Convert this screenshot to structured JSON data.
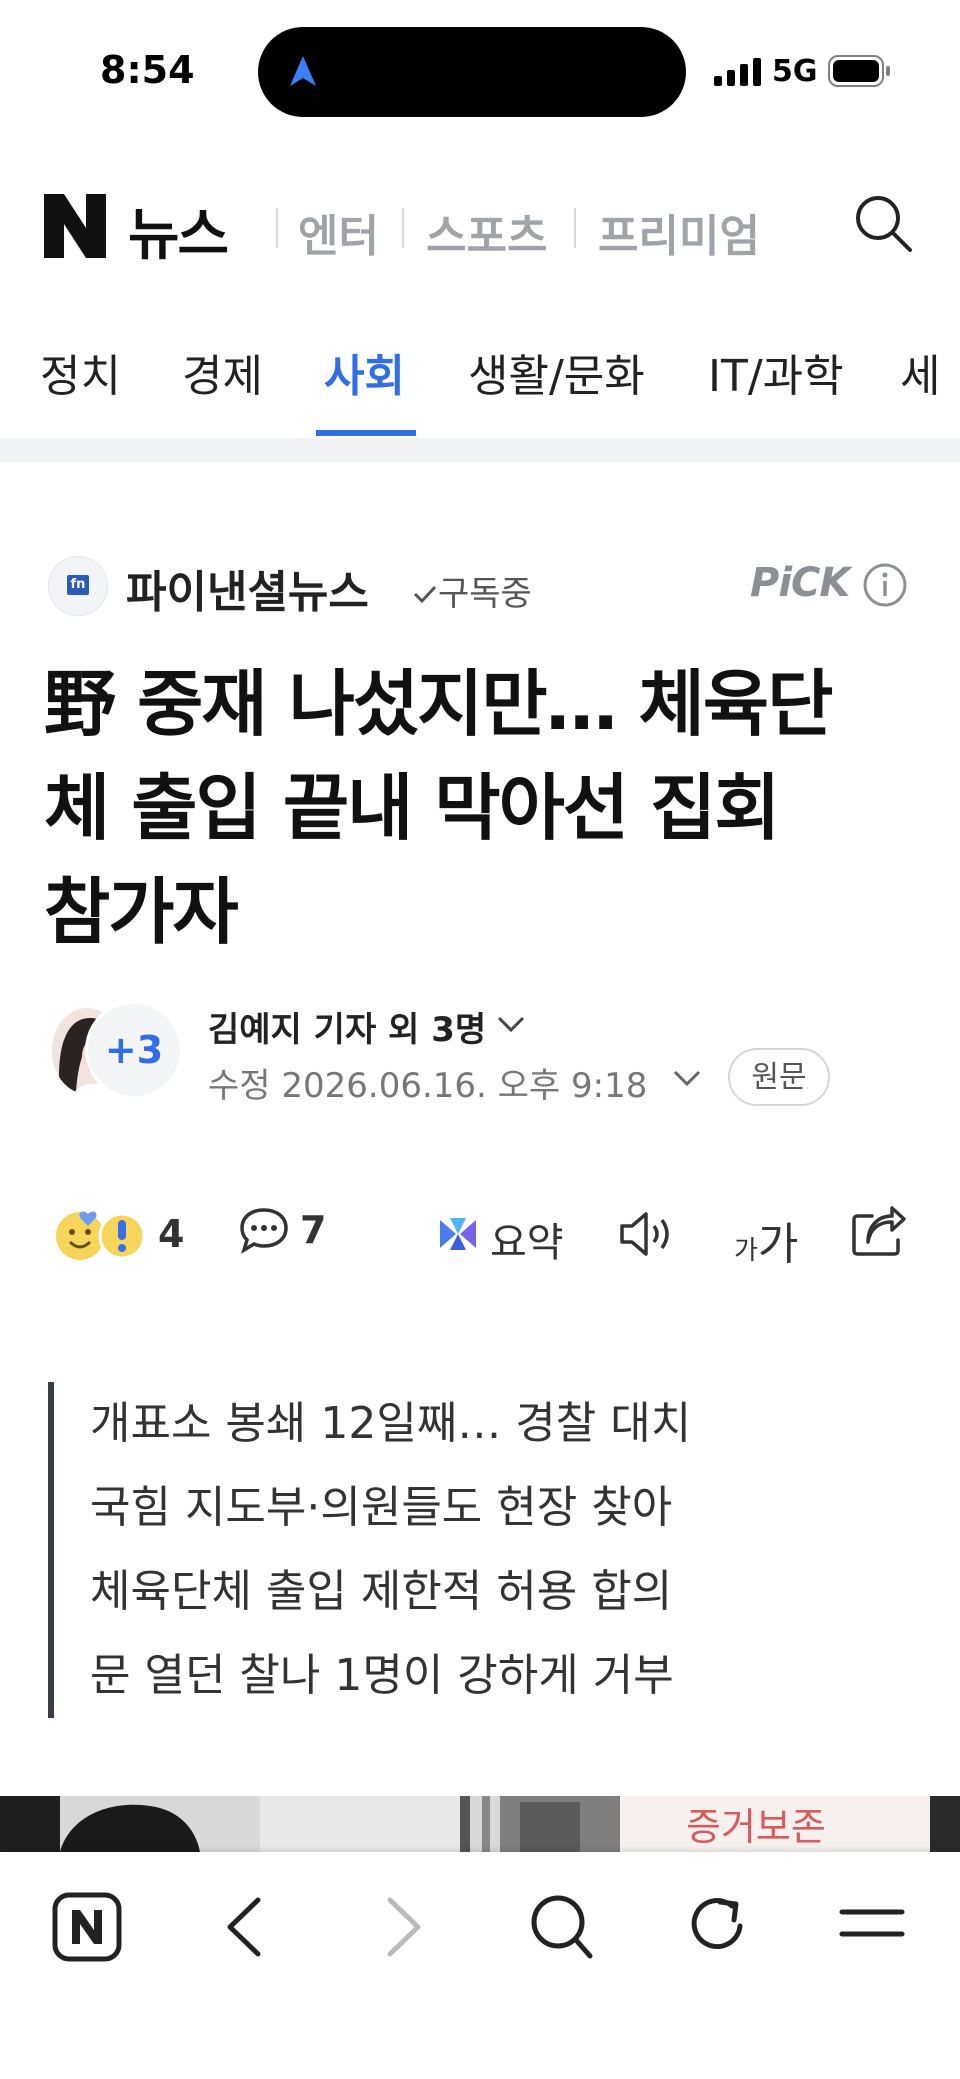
{
  "status_bar": {
    "time": "8:54",
    "network": "5G"
  },
  "header": {
    "logo_text": "뉴스",
    "links": [
      "엔터",
      "스포츠",
      "프리미엄"
    ]
  },
  "tabs": [
    {
      "label": "정치",
      "active": false
    },
    {
      "label": "경제",
      "active": false
    },
    {
      "label": "사회",
      "active": true
    },
    {
      "label": "생활/문화",
      "active": false
    },
    {
      "label": "IT/과학",
      "active": false
    },
    {
      "label": "세",
      "active": false
    }
  ],
  "article": {
    "press": {
      "name": "파이낸셜뉴스",
      "logo_text": "fn",
      "subscribe_status": "구독중"
    },
    "pick_label": "PiCK",
    "headline_lines": [
      "野 중재 나섰지만… 체육단",
      "체 출입 끝내 막아선 집회",
      "참가자"
    ],
    "reporters": {
      "extra_count": "+3",
      "name": "김예지 기자 외 3명"
    },
    "modified": "수정 2026.06.16. 오후 9:18",
    "original_button": "원문",
    "actions": {
      "reaction_count": "4",
      "comment_count": "7",
      "summary_label": "요약",
      "font_small": "가",
      "font_big": "가"
    },
    "summary_lines": [
      "개표소 봉쇄 12일째… 경찰 대치",
      "국힘 지도부·의원들도 현장 찾아",
      "체육단체 출입 제한적 허용 합의",
      "문 열던 찰나 1명이 강하게 거부"
    ],
    "photo_caption_fragment": "증거보존"
  },
  "colors": {
    "accent": "#2f6ee7",
    "muted": "#a0a3a8",
    "summary_bar": "#3a3d44"
  }
}
